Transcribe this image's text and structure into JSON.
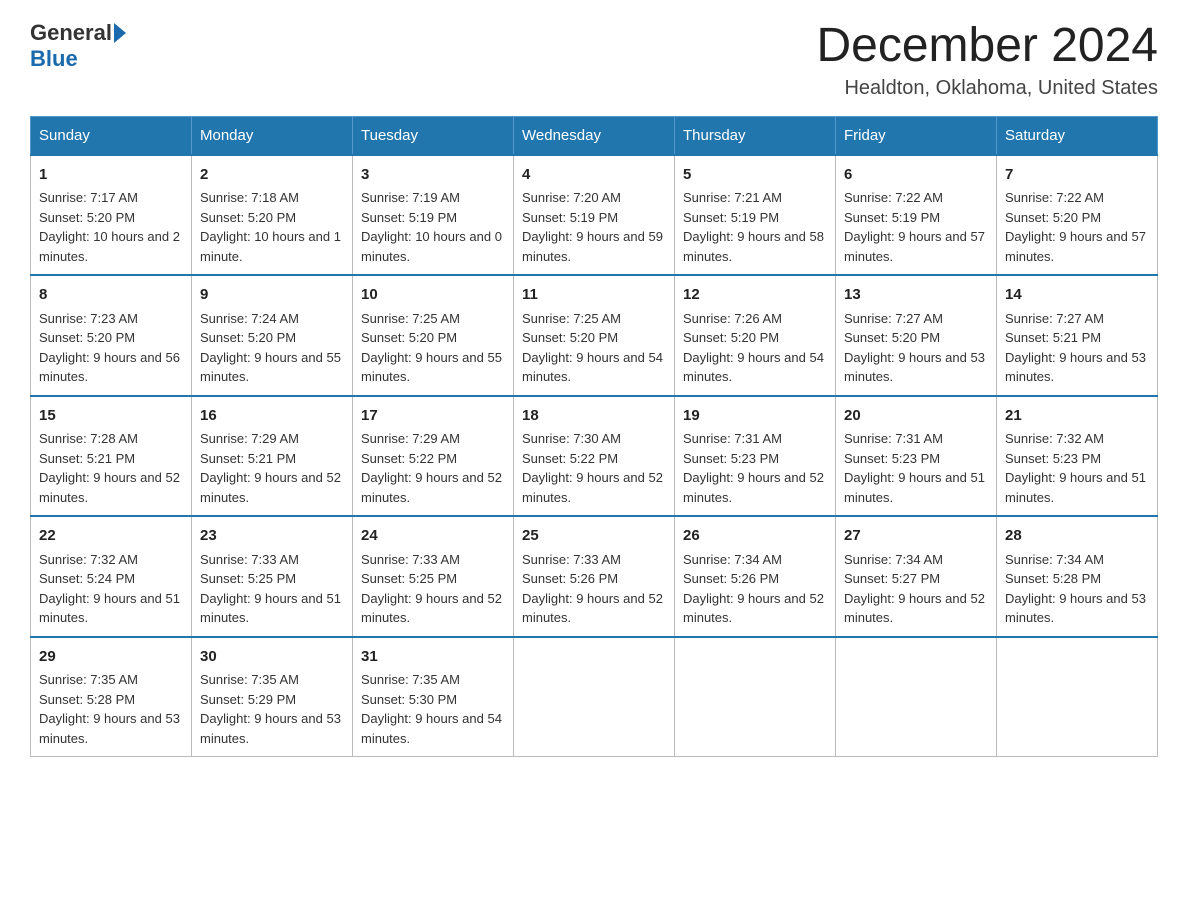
{
  "header": {
    "logo_general": "General",
    "logo_blue": "Blue",
    "month_title": "December 2024",
    "location": "Healdton, Oklahoma, United States"
  },
  "weekdays": [
    "Sunday",
    "Monday",
    "Tuesday",
    "Wednesday",
    "Thursday",
    "Friday",
    "Saturday"
  ],
  "weeks": [
    [
      {
        "day": "1",
        "sunrise": "7:17 AM",
        "sunset": "5:20 PM",
        "daylight": "10 hours and 2 minutes."
      },
      {
        "day": "2",
        "sunrise": "7:18 AM",
        "sunset": "5:20 PM",
        "daylight": "10 hours and 1 minute."
      },
      {
        "day": "3",
        "sunrise": "7:19 AM",
        "sunset": "5:19 PM",
        "daylight": "10 hours and 0 minutes."
      },
      {
        "day": "4",
        "sunrise": "7:20 AM",
        "sunset": "5:19 PM",
        "daylight": "9 hours and 59 minutes."
      },
      {
        "day": "5",
        "sunrise": "7:21 AM",
        "sunset": "5:19 PM",
        "daylight": "9 hours and 58 minutes."
      },
      {
        "day": "6",
        "sunrise": "7:22 AM",
        "sunset": "5:19 PM",
        "daylight": "9 hours and 57 minutes."
      },
      {
        "day": "7",
        "sunrise": "7:22 AM",
        "sunset": "5:20 PM",
        "daylight": "9 hours and 57 minutes."
      }
    ],
    [
      {
        "day": "8",
        "sunrise": "7:23 AM",
        "sunset": "5:20 PM",
        "daylight": "9 hours and 56 minutes."
      },
      {
        "day": "9",
        "sunrise": "7:24 AM",
        "sunset": "5:20 PM",
        "daylight": "9 hours and 55 minutes."
      },
      {
        "day": "10",
        "sunrise": "7:25 AM",
        "sunset": "5:20 PM",
        "daylight": "9 hours and 55 minutes."
      },
      {
        "day": "11",
        "sunrise": "7:25 AM",
        "sunset": "5:20 PM",
        "daylight": "9 hours and 54 minutes."
      },
      {
        "day": "12",
        "sunrise": "7:26 AM",
        "sunset": "5:20 PM",
        "daylight": "9 hours and 54 minutes."
      },
      {
        "day": "13",
        "sunrise": "7:27 AM",
        "sunset": "5:20 PM",
        "daylight": "9 hours and 53 minutes."
      },
      {
        "day": "14",
        "sunrise": "7:27 AM",
        "sunset": "5:21 PM",
        "daylight": "9 hours and 53 minutes."
      }
    ],
    [
      {
        "day": "15",
        "sunrise": "7:28 AM",
        "sunset": "5:21 PM",
        "daylight": "9 hours and 52 minutes."
      },
      {
        "day": "16",
        "sunrise": "7:29 AM",
        "sunset": "5:21 PM",
        "daylight": "9 hours and 52 minutes."
      },
      {
        "day": "17",
        "sunrise": "7:29 AM",
        "sunset": "5:22 PM",
        "daylight": "9 hours and 52 minutes."
      },
      {
        "day": "18",
        "sunrise": "7:30 AM",
        "sunset": "5:22 PM",
        "daylight": "9 hours and 52 minutes."
      },
      {
        "day": "19",
        "sunrise": "7:31 AM",
        "sunset": "5:23 PM",
        "daylight": "9 hours and 52 minutes."
      },
      {
        "day": "20",
        "sunrise": "7:31 AM",
        "sunset": "5:23 PM",
        "daylight": "9 hours and 51 minutes."
      },
      {
        "day": "21",
        "sunrise": "7:32 AM",
        "sunset": "5:23 PM",
        "daylight": "9 hours and 51 minutes."
      }
    ],
    [
      {
        "day": "22",
        "sunrise": "7:32 AM",
        "sunset": "5:24 PM",
        "daylight": "9 hours and 51 minutes."
      },
      {
        "day": "23",
        "sunrise": "7:33 AM",
        "sunset": "5:25 PM",
        "daylight": "9 hours and 51 minutes."
      },
      {
        "day": "24",
        "sunrise": "7:33 AM",
        "sunset": "5:25 PM",
        "daylight": "9 hours and 52 minutes."
      },
      {
        "day": "25",
        "sunrise": "7:33 AM",
        "sunset": "5:26 PM",
        "daylight": "9 hours and 52 minutes."
      },
      {
        "day": "26",
        "sunrise": "7:34 AM",
        "sunset": "5:26 PM",
        "daylight": "9 hours and 52 minutes."
      },
      {
        "day": "27",
        "sunrise": "7:34 AM",
        "sunset": "5:27 PM",
        "daylight": "9 hours and 52 minutes."
      },
      {
        "day": "28",
        "sunrise": "7:34 AM",
        "sunset": "5:28 PM",
        "daylight": "9 hours and 53 minutes."
      }
    ],
    [
      {
        "day": "29",
        "sunrise": "7:35 AM",
        "sunset": "5:28 PM",
        "daylight": "9 hours and 53 minutes."
      },
      {
        "day": "30",
        "sunrise": "7:35 AM",
        "sunset": "5:29 PM",
        "daylight": "9 hours and 53 minutes."
      },
      {
        "day": "31",
        "sunrise": "7:35 AM",
        "sunset": "5:30 PM",
        "daylight": "9 hours and 54 minutes."
      },
      null,
      null,
      null,
      null
    ]
  ]
}
